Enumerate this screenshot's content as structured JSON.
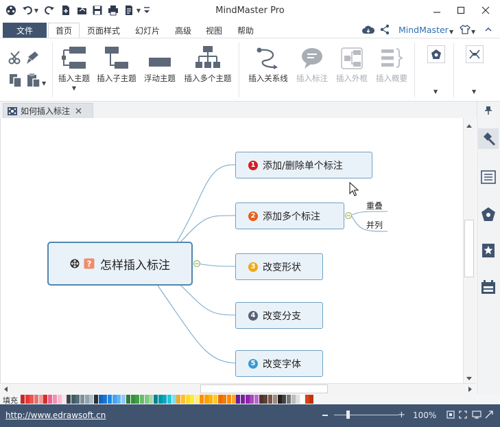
{
  "app": {
    "title": "MindMaster Pro",
    "brand": "MindMaster"
  },
  "menu": {
    "file": "文件",
    "tabs": [
      {
        "label": "首页",
        "active": true
      },
      {
        "label": "页面样式"
      },
      {
        "label": "幻灯片"
      },
      {
        "label": "高级"
      },
      {
        "label": "视图"
      },
      {
        "label": "帮助"
      }
    ]
  },
  "ribbon": {
    "insert_topic": "插入主题",
    "insert_subtopic": "插入子主题",
    "floating_topic": "浮动主题",
    "insert_multiple": "插入多个主题",
    "insert_relationship": "插入关系线",
    "insert_callout": "插入标注",
    "insert_boundary": "插入外框",
    "insert_summary": "插入概要"
  },
  "document": {
    "tab_title": "如何插入标注"
  },
  "mindmap": {
    "central": "怎样插入标注",
    "topics": [
      {
        "num": "1",
        "label": "添加/删除单个标注",
        "color": "#d0202a"
      },
      {
        "num": "2",
        "label": "添加多个标注",
        "color": "#e4601d"
      },
      {
        "num": "3",
        "label": "改变形状",
        "color": "#f0a818"
      },
      {
        "num": "4",
        "label": "改变分支",
        "color": "#56627a"
      },
      {
        "num": "5",
        "label": "改变字体",
        "color": "#3b9ad2"
      }
    ],
    "subtopics": [
      "重叠",
      "并列"
    ]
  },
  "palette": {
    "label": "填充"
  },
  "status": {
    "url": "http://www.edrawsoft.cn",
    "zoom": "100%"
  },
  "colors": {
    "file_tab": "#41546f",
    "node_fill": "#eaf2f9",
    "node_border": "#6da0c4",
    "central_border": "#4f86ad",
    "branch": "#7aaac9"
  }
}
